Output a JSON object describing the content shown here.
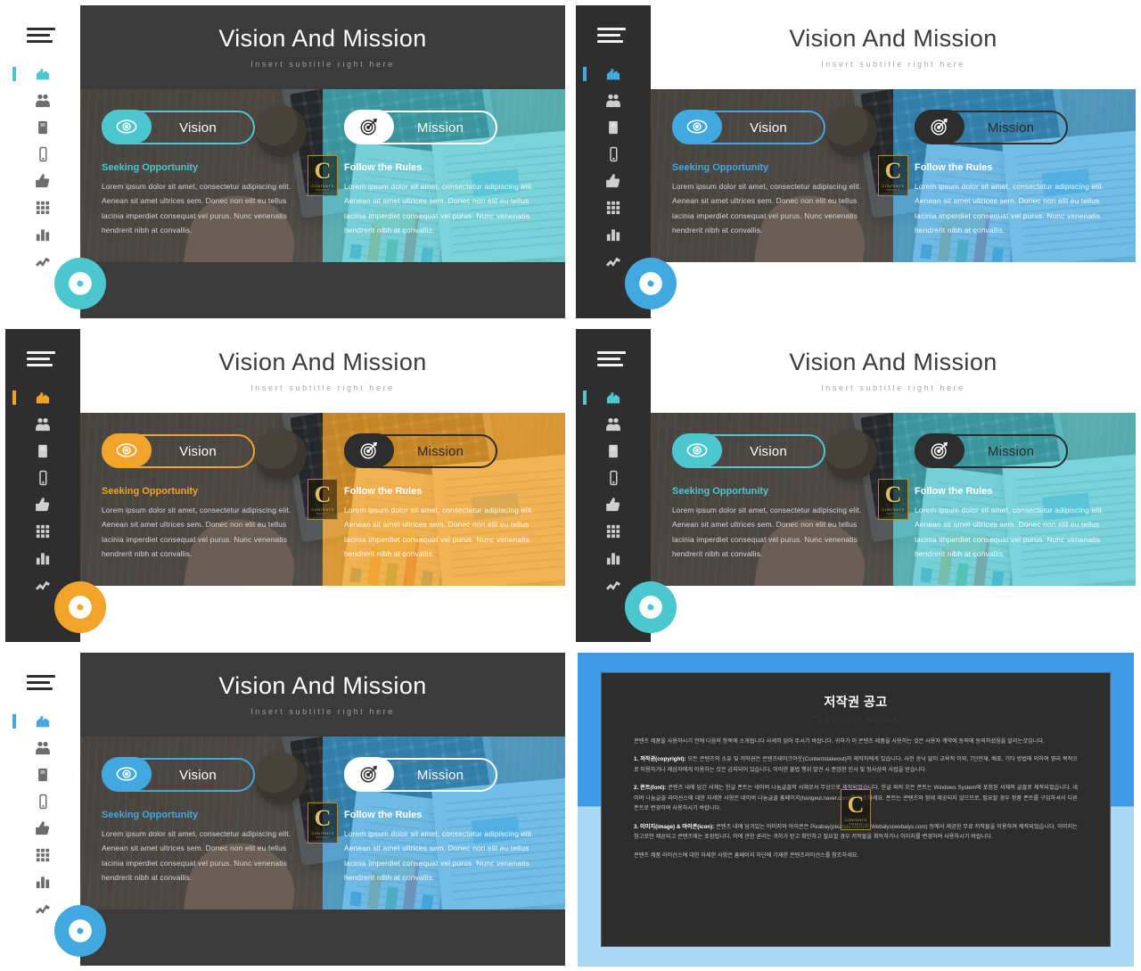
{
  "slide": {
    "title": "Vision And Mission",
    "subtitle": "Insert subtitle right here",
    "left": {
      "pill_label": "Vision",
      "heading": "Seeking Opportunity",
      "body": "Lorem ipsum dolor sit amet, consectetur adipiscing elit. Aenean sit amet ultrices sem. Donec non elit eu tellus lacinia imperdiet consequat vel purus. Nunc venenatis hendrerit nibh at convallis."
    },
    "right": {
      "pill_label": "Mission",
      "heading": "Follow the Rules",
      "body": "Lorem ipsum dolor sit amet, consectetur adipiscing elit. Aenean sit amet ultrices sem. Donec non elit eu tellus lacinia imperdiet consequat vel purus. Nunc venenatis hendrerit nibh at convallis."
    }
  },
  "sidebar": {
    "items": [
      {
        "label": "home",
        "icon": "home-icon",
        "active": true
      },
      {
        "label": "people",
        "icon": "people-icon",
        "active": false
      },
      {
        "label": "book",
        "icon": "book-icon",
        "active": false
      },
      {
        "label": "mobile",
        "icon": "mobile-icon",
        "active": false
      },
      {
        "label": "thumbs-up",
        "icon": "thumbs-up-icon",
        "active": false
      },
      {
        "label": "grid",
        "icon": "grid-icon",
        "active": false
      },
      {
        "label": "bar-chart",
        "icon": "bar-chart-icon",
        "active": false
      },
      {
        "label": "line-chart",
        "icon": "line-chart-icon",
        "active": false
      }
    ],
    "fab_icon": "disc-icon",
    "menu_icon": "hamburger-icon"
  },
  "watermark": {
    "letter": "C",
    "line1": "CONTENTS",
    "line2": "TAKEOUT"
  },
  "variants": [
    {
      "id": "variant-1",
      "accent": "#4cc6cf",
      "sidebar_theme": "light",
      "header_theme": "dark",
      "footer_theme": "dark",
      "right_tint": "rgba(76,198,207,0.72)",
      "pill_left_border": "#4cc6cf",
      "pill_left_knob": "#4cc6cf",
      "pill_left_text": "#ffffff",
      "pill_right_border": "#ffffff",
      "pill_right_knob": "#ffffff",
      "pill_right_text": "#ffffff",
      "left_head": "#4cc6cf",
      "right_head": "#ffffff"
    },
    {
      "id": "variant-2",
      "accent": "#41a8e0",
      "sidebar_theme": "dark",
      "header_theme": "light",
      "footer_theme": "light",
      "right_tint": "rgba(65,168,224,0.72)",
      "pill_left_border": "#41a8e0",
      "pill_left_knob": "#41a8e0",
      "pill_left_text": "#ffffff",
      "pill_right_border": "#2d2d2d",
      "pill_right_knob": "#2d2d2d",
      "pill_right_text": "#2d2d2d",
      "left_head": "#41a8e0",
      "right_head": "#ffffff"
    },
    {
      "id": "variant-3",
      "accent": "#f2a32a",
      "sidebar_theme": "dark",
      "header_theme": "light",
      "footer_theme": "light",
      "right_tint": "rgba(242,163,42,0.80)",
      "pill_left_border": "#f2a32a",
      "pill_left_knob": "#f2a32a",
      "pill_left_text": "#ffffff",
      "pill_right_border": "#2d2d2d",
      "pill_right_knob": "#2d2d2d",
      "pill_right_text": "#2d2d2d",
      "left_head": "#f2a32a",
      "right_head": "#ffffff"
    },
    {
      "id": "variant-4",
      "accent": "#4cc6cf",
      "sidebar_theme": "dark",
      "header_theme": "light",
      "footer_theme": "light",
      "right_tint": "rgba(76,198,207,0.72)",
      "pill_left_border": "#4cc6cf",
      "pill_left_knob": "#4cc6cf",
      "pill_left_text": "#ffffff",
      "pill_right_border": "#2d2d2d",
      "pill_right_knob": "#2d2d2d",
      "pill_right_text": "#2d2d2d",
      "left_head": "#4cc6cf",
      "right_head": "#ffffff"
    },
    {
      "id": "variant-5",
      "accent": "#41a8e0",
      "sidebar_theme": "light",
      "header_theme": "dark",
      "footer_theme": "dark",
      "right_tint": "rgba(65,168,224,0.72)",
      "pill_left_border": "#41a8e0",
      "pill_left_knob": "#41a8e0",
      "pill_left_text": "#ffffff",
      "pill_right_border": "#ffffff",
      "pill_right_knob": "#ffffff",
      "pill_right_text": "#ffffff",
      "left_head": "#41a8e0",
      "right_head": "#ffffff"
    }
  ],
  "copyright": {
    "title": "저작권 공고",
    "subtitle": "Copyright Notice",
    "intro": "콘텐츠 제품을 사용하시기 전에 다음의 항목에 소개됩니다 사세히 읽어 주시기 바랍니다. 귀하가 이 콘텐츠 제품을 사용하는 것은 사용자 계약에 동의에 동의하셨음을 알리는것입니다.",
    "sections": [
      {
        "label": "1. 저작권(copyright):",
        "text": " 모든 콘텐츠의 소유 및 저작권은 콘텐츠테이크아웃(Contentstakeout)의 제작자에게 있습니다. 사전 승낙 없이 교육적 이외, 7단전재, 배포, 기타 방법에 의하여 영리 목적으로 이용하거나 제삼자에게 이용하는 것은 금지되어 있습니다. 이러한 불법 행위 발견 시 준엄한 민사 및 형사상의 사법을 받습니다."
      },
      {
        "label": "2. 폰트(font):",
        "text": " 콘텐츠 내에 담긴 서체는 한글 폰트는 네이버 나눔글꼴의 서체로서 무상으로 제작되었습니다. 한글 외의 모든 폰트는 Windows System에 포함된 서체의 글꼴로 제작되었습니다. 네이버 나눔글꼴 라이선스에 대한 자세한 사항은 네이버 나눔글꼴 홈페이지(hangeul.naver.com)를 참조하세요. 폰트는 콘텐츠와 함께 제공되지 않으므로, 필요할 경우 정품 폰트를 구입하셔서 다른 폰트로 변경하여 사용하시기 바랍니다."
      },
      {
        "label": "3. 이미지(image) & 아이콘(icon):",
        "text": " 콘텐츠 내에 담겨있는 이미지와 아이콘은 Pixabay(pixabay.com)와 Webalys(webalys.com) 등에서 제공한 무료 저작물을 이용하여 제작되었습니다. 이미지는 참고로만 제공되고 콘텐츠에는 포함됩니다. 이에 관한 권리는 귀하가 받고 확인하고 필요할 경우 저작물을 취득하거나 이미지를 변경하여 사용하시기 바랍니다."
      }
    ],
    "footer": "콘텐츠 제품 라이선스에 대한 자세한 사항은 홈페이지 하단에 기재한 콘텐츠라이선스를 참조하세요."
  }
}
